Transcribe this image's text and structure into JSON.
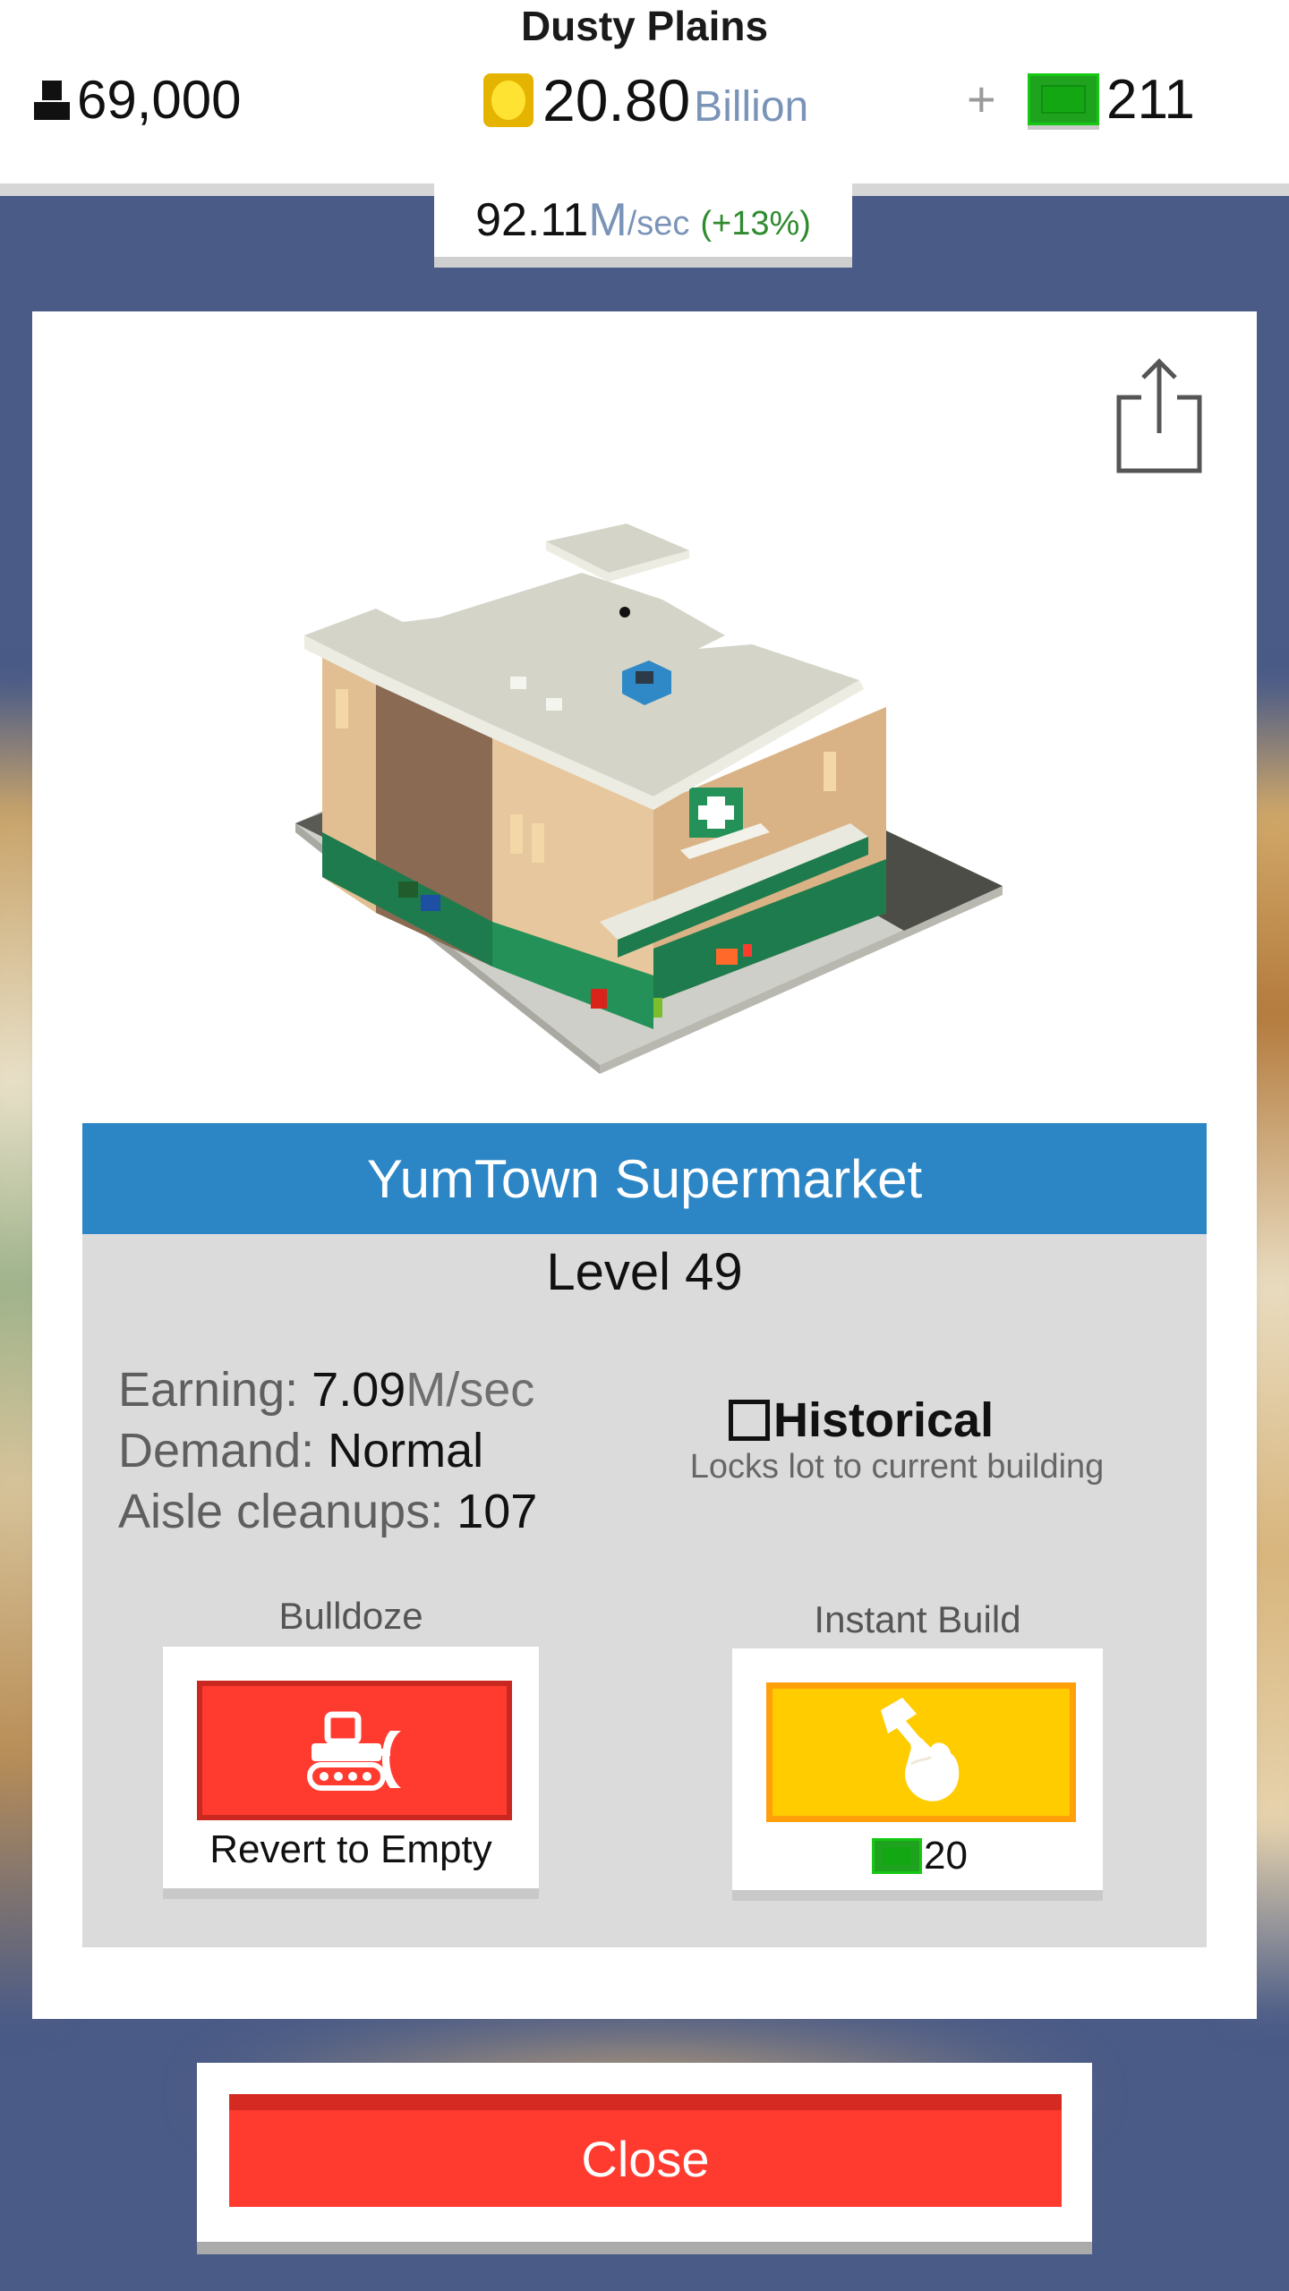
{
  "city": {
    "name": "Dusty Plains"
  },
  "hud": {
    "population": "69,000",
    "money_value": "20.80",
    "money_unit": "Billion",
    "plus_label": "+",
    "cash": "211",
    "rate_value": "92.11",
    "rate_unit_m": "M",
    "rate_unit": "/sec",
    "rate_bonus": "(+13%)"
  },
  "building": {
    "name": "YumTown Supermarket",
    "level": "Level 49",
    "earning_label": "Earning:",
    "earning_value": "7.09",
    "earning_unit": "M/sec",
    "demand_label": "Demand:",
    "demand_value": "Normal",
    "cleanups_label": "Aisle cleanups:",
    "cleanups_value": "107",
    "historical_label": "Historical",
    "historical_checked": false,
    "historical_sub": "Locks lot to current building"
  },
  "actions": {
    "bulldoze_label": "Bulldoze",
    "bulldoze_caption": "Revert to Empty",
    "instant_label": "Instant Build",
    "instant_cost": "20"
  },
  "close_label": "Close",
  "icons": {
    "population": "person-icon",
    "money": "coin-icon",
    "cash": "cash-bill-icon",
    "share": "share-icon",
    "bulldoze": "bulldozer-icon",
    "instant": "hammer-hand-icon"
  },
  "colors": {
    "title_bar": "#2c86c5",
    "bulldoze": "#ff3b30",
    "instant_build": "#ffcc00",
    "close": "#ff3b30",
    "background": "#4a5b87"
  }
}
